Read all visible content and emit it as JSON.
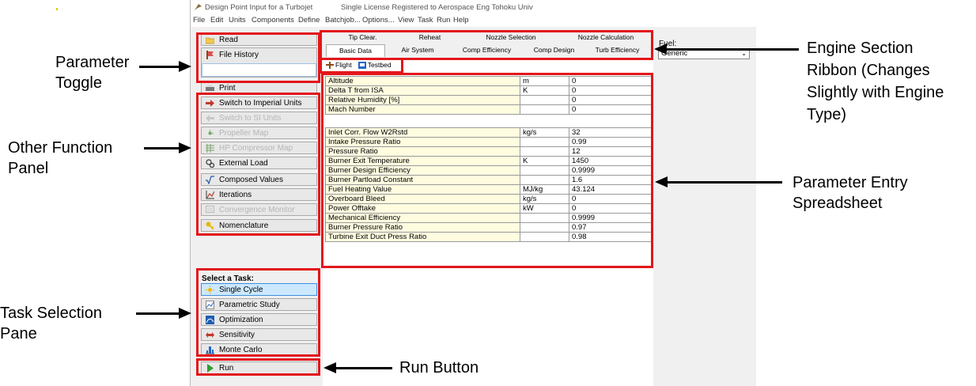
{
  "window": {
    "title": "Design Point Input for a Turbojet",
    "license": "Single License Registered to Aerospace Eng Tohoku Univ"
  },
  "menu": [
    "File",
    "Edit",
    "Units",
    "Components",
    "Define",
    "Batchjob...",
    "Options...",
    "View",
    "Task",
    "Run",
    "Help"
  ],
  "sidebar": {
    "read": "Read",
    "file_history": "File History",
    "print": "Print",
    "functions": [
      {
        "label": "Switch to Imperial Units",
        "enabled": true
      },
      {
        "label": "Switch to SI Units",
        "enabled": false
      },
      {
        "label": "Propeller Map",
        "enabled": false
      },
      {
        "label": "HP Compressor Map",
        "enabled": false
      },
      {
        "label": "External Load",
        "enabled": true
      },
      {
        "label": "Composed Values",
        "enabled": true
      },
      {
        "label": "Iterations",
        "enabled": true
      },
      {
        "label": "Convergence Monitor",
        "enabled": false
      },
      {
        "label": "Nomenclature",
        "enabled": true
      }
    ],
    "task_heading": "Select a Task:",
    "tasks": [
      "Single Cycle",
      "Parametric Study",
      "Optimization",
      "Sensitivity",
      "Monte Carlo"
    ],
    "run": "Run"
  },
  "tabs": {
    "row1": [
      "Tip Clear.",
      "Reheat",
      "Nozzle Selection",
      "Nozzle Calculation"
    ],
    "row2": [
      "Basic Data",
      "Air System",
      "Comp Efficiency",
      "Comp Design",
      "Turb Efficiency"
    ]
  },
  "toggles": [
    "Flight",
    "Testbed"
  ],
  "fuel": {
    "label": "Fuel:",
    "value": "Generic"
  },
  "flight_params": [
    {
      "name": "Altitude",
      "unit": "m",
      "value": "0"
    },
    {
      "name": "Delta T from ISA",
      "unit": "K",
      "value": "0"
    },
    {
      "name": "Relative Humidity [%]",
      "unit": "",
      "value": "0"
    },
    {
      "name": "Mach Number",
      "unit": "",
      "value": "0"
    }
  ],
  "engine_params": [
    {
      "name": "Inlet Corr. Flow W2Rstd",
      "unit": "kg/s",
      "value": "32"
    },
    {
      "name": "Intake Pressure Ratio",
      "unit": "",
      "value": "0.99"
    },
    {
      "name": "Pressure Ratio",
      "unit": "",
      "value": "12"
    },
    {
      "name": "Burner Exit Temperature",
      "unit": "K",
      "value": "1450"
    },
    {
      "name": "Burner Design Efficiency",
      "unit": "",
      "value": "0.9999"
    },
    {
      "name": "Burner Partload Constant",
      "unit": "",
      "value": "1.6"
    },
    {
      "name": "Fuel Heating Value",
      "unit": "MJ/kg",
      "value": "43.124"
    },
    {
      "name": "Overboard Bleed",
      "unit": "kg/s",
      "value": "0"
    },
    {
      "name": "Power Offtake",
      "unit": "kW",
      "value": "0"
    },
    {
      "name": "Mechanical Efficiency",
      "unit": "",
      "value": "0.9999"
    },
    {
      "name": "Burner Pressure Ratio",
      "unit": "",
      "value": "0.97"
    },
    {
      "name": "Turbine Exit Duct Press Ratio",
      "unit": "",
      "value": "0.98"
    }
  ],
  "annotations": {
    "parameter_toggle": [
      "Parameter",
      "Toggle"
    ],
    "other_function": [
      "Other Function",
      "Panel"
    ],
    "task_selection": [
      "Task Selection",
      "Pane"
    ],
    "run_button": "Run Button",
    "engine_section": [
      "Engine Section",
      "Ribbon (Changes",
      "Slightly with Engine",
      "Type)"
    ],
    "parameter_entry": [
      "Parameter Entry",
      "Spreadsheet"
    ]
  },
  "colors": {
    "highlight": "#e3161b",
    "param_bg": "#fffce0",
    "selected_task": "#cce8ff"
  }
}
